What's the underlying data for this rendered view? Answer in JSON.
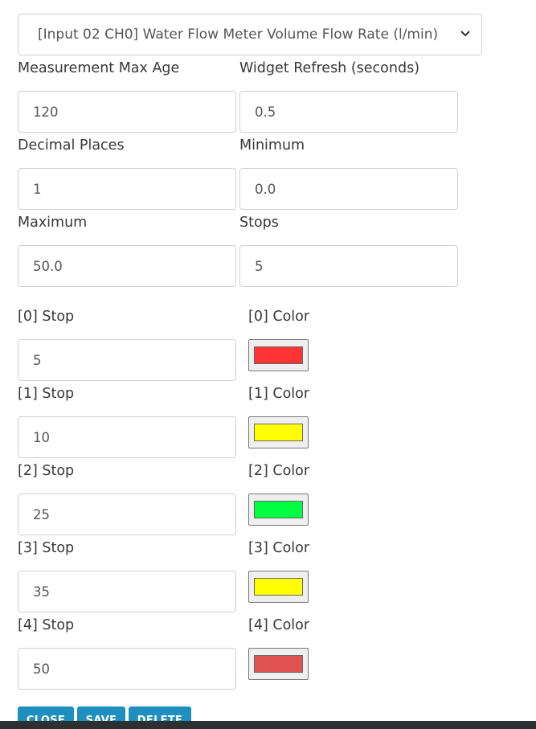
{
  "select": {
    "value": "[Input 02 CH0] Water Flow Meter Volume Flow Rate (l/min)"
  },
  "fields": {
    "max_age": {
      "label": "Measurement Max Age",
      "value": "120"
    },
    "refresh": {
      "label": "Widget Refresh (seconds)",
      "value": "0.5"
    },
    "decimal": {
      "label": "Decimal Places",
      "value": "1"
    },
    "minimum": {
      "label": "Minimum",
      "value": "0.0"
    },
    "maximum": {
      "label": "Maximum",
      "value": "50.0"
    },
    "stops": {
      "label": "Stops",
      "value": "5"
    }
  },
  "stop_rows": [
    {
      "stop_label": "[0] Stop",
      "stop_value": "5",
      "color_label": "[0] Color",
      "color": "#ff3333"
    },
    {
      "stop_label": "[1] Stop",
      "stop_value": "10",
      "color_label": "[1] Color",
      "color": "#ffff00"
    },
    {
      "stop_label": "[2] Stop",
      "stop_value": "25",
      "color_label": "[2] Color",
      "color": "#00ff40"
    },
    {
      "stop_label": "[3] Stop",
      "stop_value": "35",
      "color_label": "[3] Color",
      "color": "#ffff00"
    },
    {
      "stop_label": "[4] Stop",
      "stop_value": "50",
      "color_label": "[4] Color",
      "color": "#e05252"
    }
  ],
  "buttons": {
    "close": "CLOSE",
    "save": "SAVE",
    "delete": "DELETE"
  }
}
